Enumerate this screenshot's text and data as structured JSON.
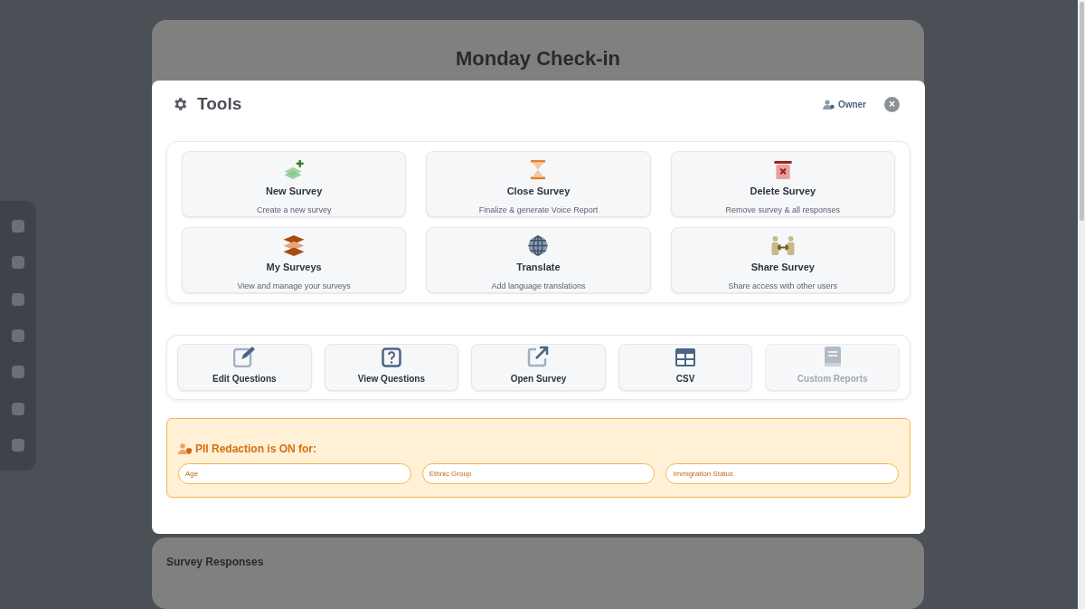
{
  "background_page": {
    "title": "Monday Check-in",
    "section_title": "Survey Responses"
  },
  "modal": {
    "title": "Tools",
    "role": "Owner",
    "close": "×"
  },
  "tools": [
    {
      "kind": "new",
      "title": "New Survey",
      "subtitle": "Create a new survey"
    },
    {
      "kind": "close",
      "title": "Close Survey",
      "subtitle": "Finalize & generate Voice Report"
    },
    {
      "kind": "delete",
      "title": "Delete Survey",
      "subtitle": "Remove survey & all responses"
    },
    {
      "kind": "list",
      "title": "My Surveys",
      "subtitle": "View and manage your surveys"
    },
    {
      "kind": "translate",
      "title": "Translate",
      "subtitle": "Add language translations"
    },
    {
      "kind": "share",
      "title": "Share Survey",
      "subtitle": "Share access with other users"
    }
  ],
  "actions": [
    {
      "kind": "edit",
      "label": "Edit Questions",
      "disabled": false
    },
    {
      "kind": "view",
      "label": "View Questions",
      "disabled": false
    },
    {
      "kind": "open",
      "label": "Open Survey",
      "disabled": false
    },
    {
      "kind": "csv",
      "label": "CSV",
      "disabled": false
    },
    {
      "kind": "report",
      "label": "Custom Reports",
      "disabled": true
    }
  ],
  "redaction": {
    "title": "PII Redaction is ON for:",
    "fields": [
      "Age",
      "Ethnic Group",
      "Immigration Status"
    ]
  }
}
